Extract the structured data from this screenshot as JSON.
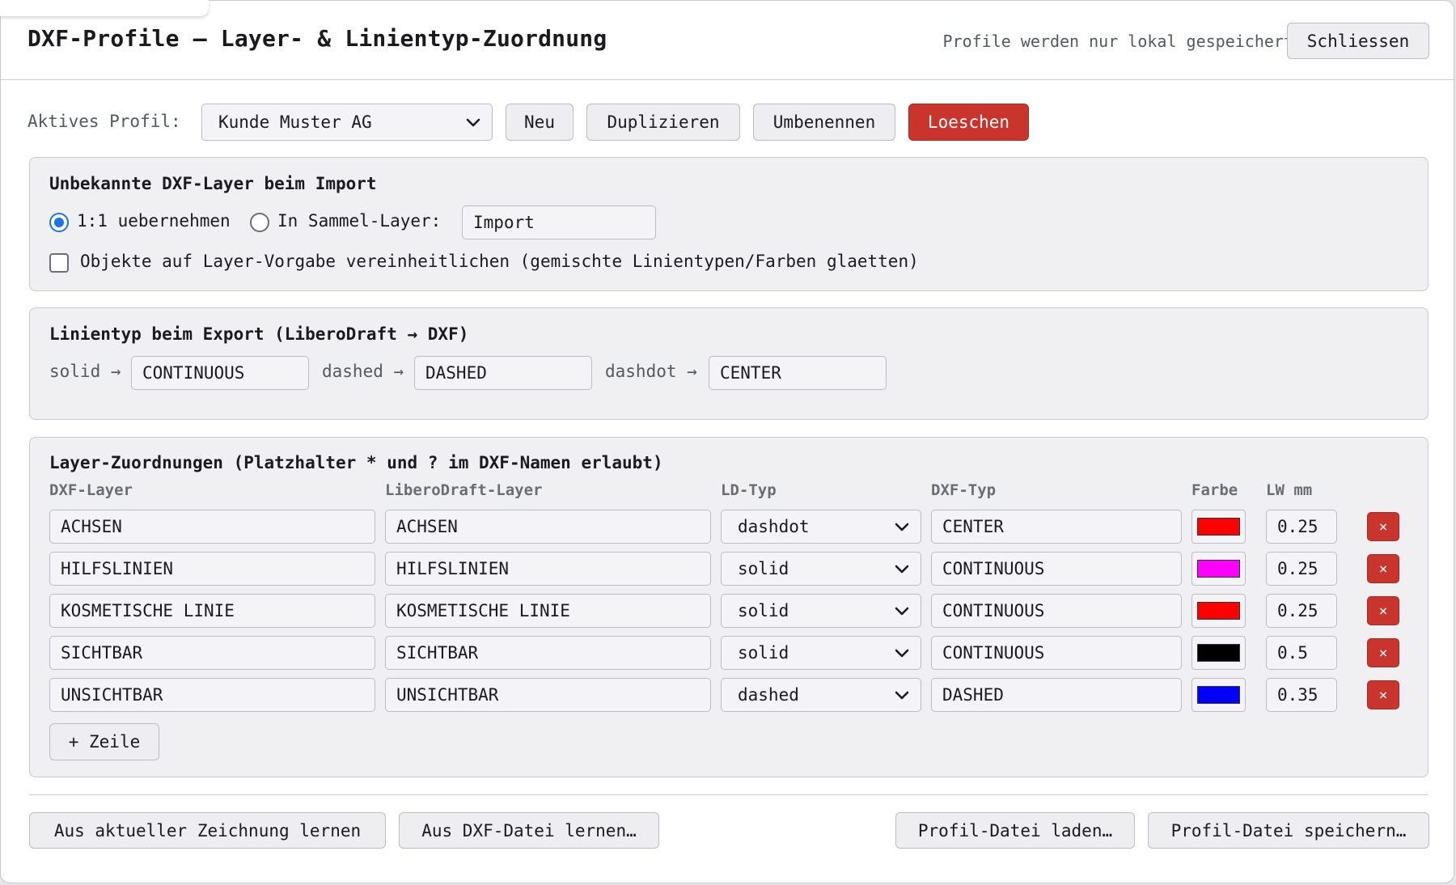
{
  "header": {
    "title": "DXF-Profile — Layer- & Linientyp-Zuordnung",
    "hint": "Profile werden nur lokal gespeichert",
    "close_label": "Schliessen"
  },
  "profile_bar": {
    "label": "Aktives Profil:",
    "selected": "Kunde Muster AG",
    "new_label": "Neu",
    "duplicate_label": "Duplizieren",
    "rename_label": "Umbenennen",
    "delete_label": "Loeschen"
  },
  "import_section": {
    "title": "Unbekannte DXF-Layer beim Import",
    "option_keep": "1:1 uebernehmen",
    "option_collect": "In Sammel-Layer:",
    "collect_layer": "Import",
    "selected_option": "keep",
    "unify_label": "Objekte auf Layer-Vorgabe vereinheitlichen (gemischte Linientypen/Farben glaetten)",
    "unify_checked": false
  },
  "export_section": {
    "title": "Linientyp beim Export (LiberoDraft → DXF)",
    "mappings": [
      {
        "ld": "solid →",
        "dxf": "CONTINUOUS"
      },
      {
        "ld": "dashed →",
        "dxf": "DASHED"
      },
      {
        "ld": "dashdot →",
        "dxf": "CENTER"
      }
    ]
  },
  "layer_section": {
    "title": "Layer-Zuordnungen (Platzhalter * und ? im DXF-Namen erlaubt)",
    "columns": [
      "DXF-Layer",
      "LiberoDraft-Layer",
      "LD-Typ",
      "DXF-Typ",
      "Farbe",
      "LW mm"
    ],
    "rows": [
      {
        "dxf_layer": "ACHSEN",
        "ld_layer": "ACHSEN",
        "ld_type": "dashdot",
        "dxf_type": "CENTER",
        "color": "#ff0000",
        "lw": "0.25"
      },
      {
        "dxf_layer": "HILFSLINIEN",
        "ld_layer": "HILFSLINIEN",
        "ld_type": "solid",
        "dxf_type": "CONTINUOUS",
        "color": "#ff00ff",
        "lw": "0.25"
      },
      {
        "dxf_layer": "KOSMETISCHE LINIE",
        "ld_layer": "KOSMETISCHE LINIE",
        "ld_type": "solid",
        "dxf_type": "CONTINUOUS",
        "color": "#ff0000",
        "lw": "0.25"
      },
      {
        "dxf_layer": "SICHTBAR",
        "ld_layer": "SICHTBAR",
        "ld_type": "solid",
        "dxf_type": "CONTINUOUS",
        "color": "#000000",
        "lw": "0.5"
      },
      {
        "dxf_layer": "UNSICHTBAR",
        "ld_layer": "UNSICHTBAR",
        "ld_type": "dashed",
        "dxf_type": "DASHED",
        "color": "#0000ff",
        "lw": "0.35"
      }
    ],
    "delete_glyph": "×",
    "add_row_label": "+ Zeile"
  },
  "footer": {
    "learn_drawing_label": "Aus aktueller Zeichnung lernen",
    "learn_dxf_label": "Aus DXF-Datei lernen…",
    "load_profile_label": "Profil-Datei laden…",
    "save_profile_label": "Profil-Datei speichern…"
  },
  "colors": {
    "accent": "#1a73e8",
    "danger": "#c9342c"
  }
}
